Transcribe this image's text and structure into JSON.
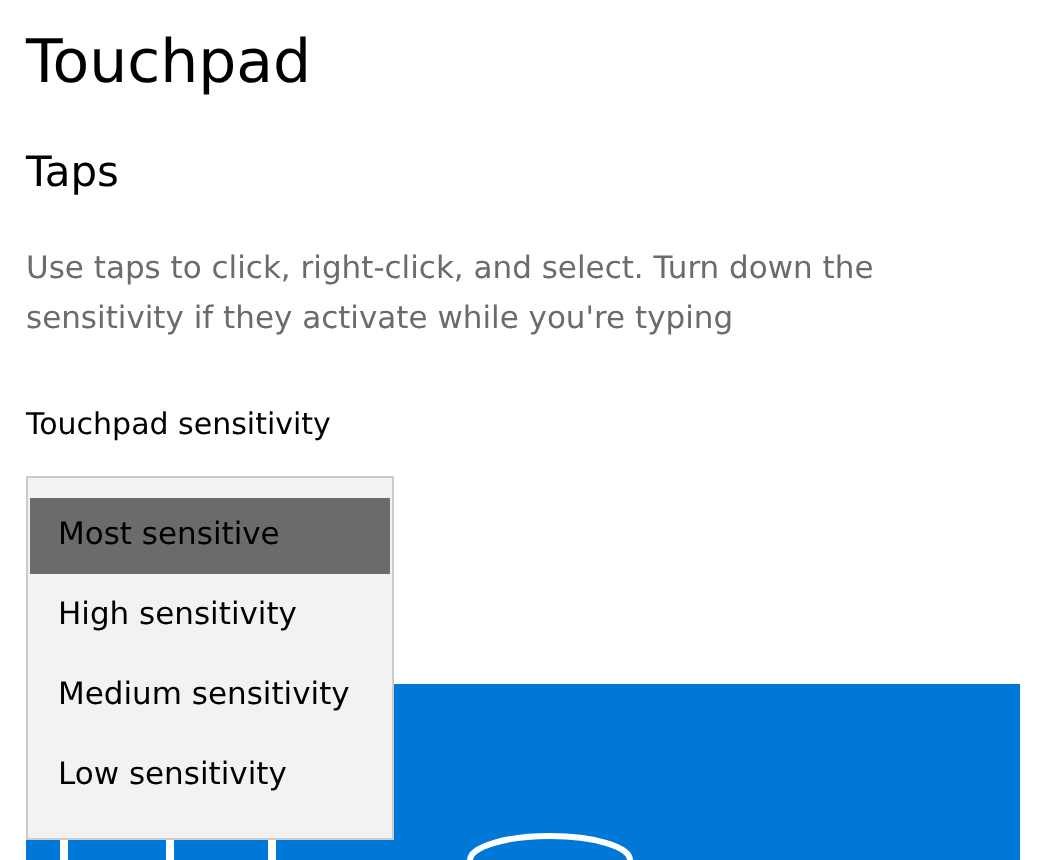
{
  "page": {
    "title": "Touchpad"
  },
  "section": {
    "title": "Taps",
    "description": "Use taps to click, right-click, and select. Turn down the sensitivity if they activate while you're typing"
  },
  "sensitivity": {
    "label": "Touchpad sensitivity",
    "options": [
      {
        "label": "Most sensitive",
        "selected": true
      },
      {
        "label": "High sensitivity",
        "selected": false
      },
      {
        "label": "Medium sensitivity",
        "selected": false
      },
      {
        "label": "Low sensitivity",
        "selected": false
      }
    ]
  }
}
